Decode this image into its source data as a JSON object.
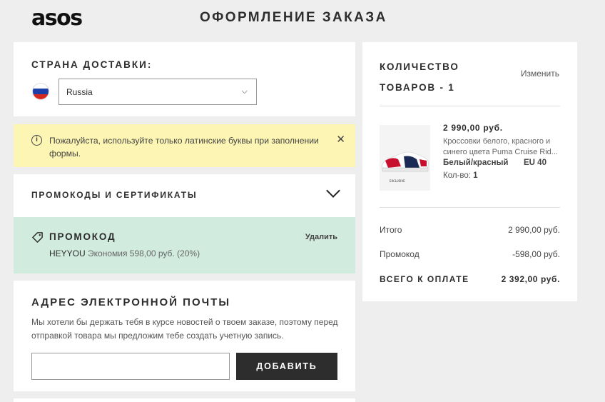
{
  "header": {
    "logo": "asos",
    "title": "ОФОРМЛЕНИЕ ЗАКАЗА"
  },
  "country": {
    "heading": "СТРАНА ДОСТАВКИ:",
    "selected": "Russia"
  },
  "warning": {
    "text": "Пожалуйста, используйте только латинские буквы при заполнении формы."
  },
  "promo": {
    "heading": "ПРОМОКОДЫ И СЕРТИФИКАТЫ",
    "applied_label": "ПРОМОКОД",
    "remove_label": "Удалить",
    "code": "HEYYOU",
    "saving": "Экономия 598,00 руб. (20%)"
  },
  "email": {
    "heading": "АДРЕС ЭЛЕКТРОННОЙ ПОЧТЫ",
    "description": "Мы хотели бы держать тебя в курсе новостей о твоем заказе, поэтому перед отправкой товара мы предложим тебе создать учетную запись.",
    "input_value": "",
    "add_button": "ДОБАВИТЬ"
  },
  "summary": {
    "qty_heading": "КОЛИЧЕСТВО ТОВАРОВ - 1",
    "change_link": "Изменить",
    "item": {
      "price": "2 990,00 руб.",
      "name": "Кроссовки белого, красного и синего цвета Puma Cruise Rid...",
      "color": "Белый/красный",
      "size": "EU 40",
      "qty_label": "Кол-во:",
      "qty": "1",
      "image_caption": "EXCLUSIVE"
    },
    "subtotal_label": "Итого",
    "subtotal_value": "2 990,00 руб.",
    "promo_label": "Промокод",
    "promo_value": "-598,00 руб.",
    "total_label": "ВСЕГО К ОПЛАТЕ",
    "total_value": "2 392,00 руб."
  },
  "colors": {
    "warning_bg": "#fcf5b4",
    "promo_bg": "#d1ebdf",
    "button_bg": "#2d2d2d",
    "page_bg": "#eeeeee"
  }
}
